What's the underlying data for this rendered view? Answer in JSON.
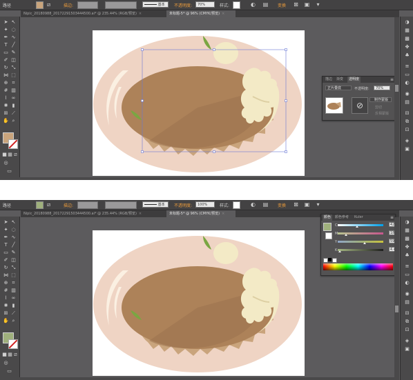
{
  "top": {
    "control_bar": {
      "selection_type": "路径",
      "stroke_label": "描边:",
      "brush_label": "基本",
      "opacity_label": "不透明度:",
      "opacity_value": "70%",
      "style_label": "样式:",
      "transform_label": "变换",
      "fill_color": "#c9a47c"
    },
    "tabs": [
      {
        "label": "Nipic_20180988_20172291503444500.ai* @ 235.44% (RGB/预览)",
        "close": "×"
      },
      {
        "label": "未标题-5* @ 96% (CMYK/预览)",
        "close": "×"
      }
    ],
    "tools": {
      "fill_color": "#c9a47c"
    },
    "transparency_panel": {
      "tabs": [
        "描边",
        "渐变",
        "透明度"
      ],
      "menu_icon": "≡",
      "blend_mode": "正片叠底",
      "opacity_label": "不透明度:",
      "opacity_value": "70%",
      "make_mask_button": "制作蒙版",
      "clip_label": "剪切",
      "invert_label": "反相蒙版",
      "no_mask_icon": "⊘"
    }
  },
  "bottom": {
    "control_bar": {
      "selection_type": "路径",
      "stroke_label": "描边:",
      "brush_label": "基本",
      "opacity_label": "不透明度:",
      "opacity_value": "100%",
      "style_label": "样式:",
      "transform_label": "变换",
      "fill_color": "#9fb07c"
    },
    "tabs": [
      {
        "label": "Nipic_20180988_20172291503444500.ai* @ 235.44% (RGB/预览)",
        "close": "×"
      },
      {
        "label": "未标题-5* @ 96% (CMYK/预览)",
        "close": "×"
      }
    ],
    "tools": {
      "fill_color": "#9fb07c"
    },
    "color_panel": {
      "tabs": [
        "颜色",
        "颜色参考",
        "Kuler"
      ],
      "menu_icon": "≡",
      "sliders": [
        {
          "label": "C",
          "value": "42.7",
          "unit": "%",
          "fraction": 0.427
        },
        {
          "label": "M",
          "value": "18.1",
          "unit": "%",
          "fraction": 0.181
        },
        {
          "label": "Y",
          "value": "59.8",
          "unit": "%",
          "fraction": 0.598
        },
        {
          "label": "K",
          "value": "4.43",
          "unit": "%",
          "fraction": 0.0443
        }
      ],
      "swatch_color": "#9fb07c"
    }
  },
  "colors": {
    "plate": "#efd4c4",
    "plate_highlight": "#fbf0e2",
    "crust": "#c9a47c",
    "cake_top": "#ad8259",
    "cake_shadow": "#9b734e",
    "cream": "#f3eac6",
    "cream_shadow": "#ddcfa3",
    "leaf": "#7aa642",
    "selection": "#6a78d6"
  }
}
